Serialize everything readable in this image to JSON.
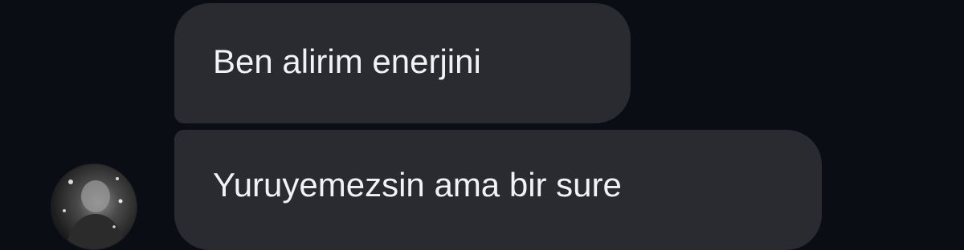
{
  "conversation": {
    "messages": [
      {
        "text": "Ben alirim enerjini"
      },
      {
        "text": "Yuruyemezsin ama bir sure"
      }
    ]
  },
  "colors": {
    "background": "#0a0d14",
    "bubble": "#2a2b31",
    "text": "#f2f2f4"
  },
  "icons": {
    "avatar": "profile-photo"
  }
}
